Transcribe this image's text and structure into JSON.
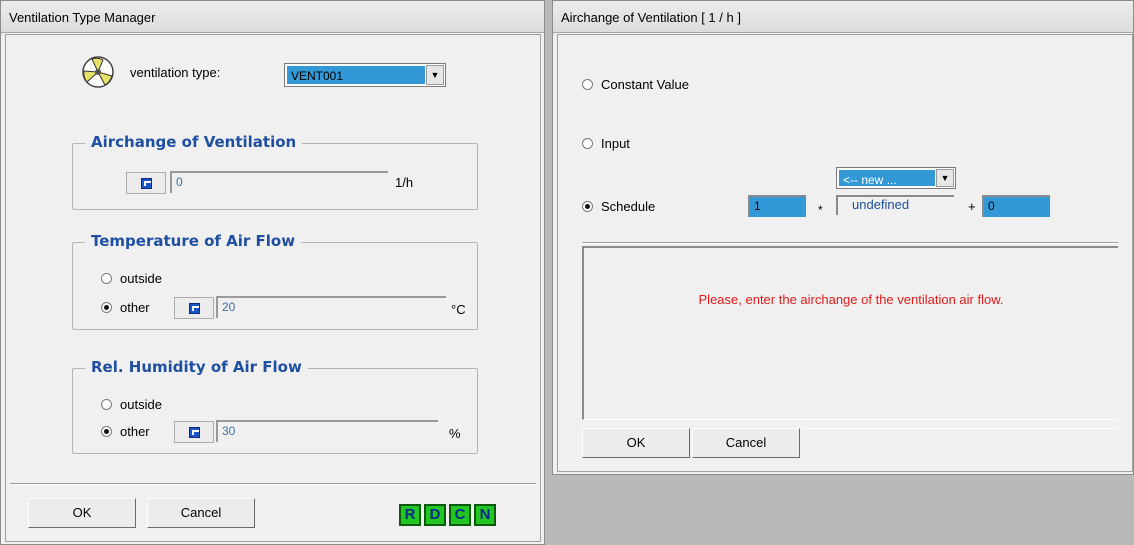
{
  "left_window": {
    "title": "Ventilation Type Manager",
    "ventilation_type_label": "ventilation type:",
    "ventilation_type_value": "VENT001",
    "airchange_group": {
      "title": "Airchange of Ventilation",
      "value": "0",
      "unit": "1/h"
    },
    "temperature_group": {
      "title": "Temperature of Air Flow",
      "option_outside": "outside",
      "option_other": "other",
      "selected": "other",
      "value": "20",
      "unit": "°C"
    },
    "humidity_group": {
      "title": "Rel. Humidity of Air Flow",
      "option_outside": "outside",
      "option_other": "other",
      "selected": "other",
      "value": "30",
      "unit": "%"
    },
    "ok_label": "OK",
    "cancel_label": "Cancel",
    "rdcn": [
      "R",
      "D",
      "C",
      "N"
    ]
  },
  "right_window": {
    "title": "Airchange of Ventilation  [ 1 / h ]",
    "option_constant": "Constant Value",
    "option_input": "Input",
    "option_schedule": "Schedule",
    "selected": "Schedule",
    "factor": "1",
    "multiply_sign": "*",
    "schedule_combo_value": "<-- new ...",
    "schedule_name": "undefined",
    "plus_sign": "+",
    "offset": "0",
    "message": "Please, enter the airchange of the ventilation air flow.",
    "ok_label": "OK",
    "cancel_label": "Cancel"
  },
  "colors": {
    "group_title": "#1f4fa0",
    "message": "#e31b1b",
    "highlight": "#3399d6",
    "rdcn_green": "#22c622"
  }
}
